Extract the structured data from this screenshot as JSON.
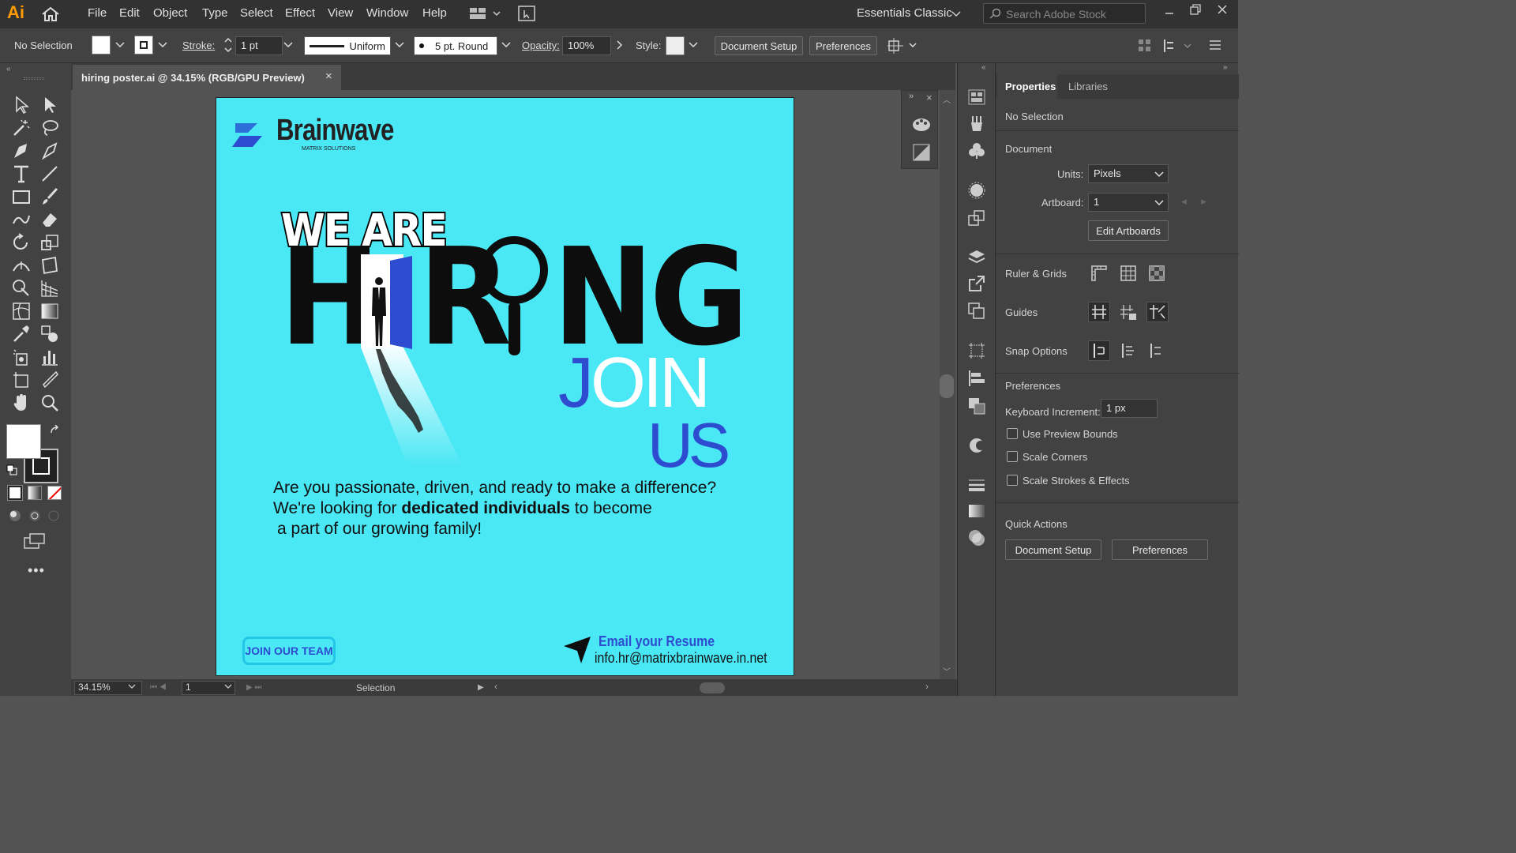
{
  "app": {
    "logo": "Ai",
    "home_icon": "home-icon"
  },
  "menu": [
    "File",
    "Edit",
    "Object",
    "Type",
    "Select",
    "Effect",
    "View",
    "Window",
    "Help"
  ],
  "workspace": "Essentials Classic",
  "search_placeholder": "Search Adobe Stock",
  "control": {
    "selection": "No Selection",
    "stroke_label": "Stroke:",
    "stroke_value": "1 pt",
    "profile": "Uniform",
    "brush": "5 pt. Round",
    "opacity_label": "Opacity:",
    "opacity_value": "100%",
    "style_label": "Style:",
    "doc_setup": "Document Setup",
    "preferences": "Preferences"
  },
  "document": {
    "tab_title": "hiring poster.ai @ 34.15% (RGB/GPU Preview)",
    "close": "×"
  },
  "poster": {
    "brand": "Brainwave",
    "brand_sub": "MATRIX SOLUTIONS",
    "we_are": "WE ARE",
    "hiring_h": "H",
    "hiring_r": "R",
    "hiring_ng": "NG",
    "join": "JOIN",
    "us": "US",
    "line1": "Are you passionate, driven, and ready to make a difference?",
    "line2a": "We're looking for ",
    "line2b": "dedicated individuals",
    "line2c": " to become",
    "line3": "a part of our growing family!",
    "cta": "JOIN OUR TEAM",
    "email_title": "Email your Resume",
    "email": "info.hr@matrixbrainwave.in.net",
    "colors": {
      "bg": "#4ae7f5",
      "blue": "#2d4ccf",
      "dark": "#111111"
    }
  },
  "properties": {
    "tab_properties": "Properties",
    "tab_libraries": "Libraries",
    "no_selection": "No Selection",
    "document": "Document",
    "units_label": "Units:",
    "units_value": "Pixels",
    "artboard_label": "Artboard:",
    "artboard_value": "1",
    "edit_artboards": "Edit Artboards",
    "ruler_grids": "Ruler & Grids",
    "guides": "Guides",
    "snap_options": "Snap Options",
    "preferences": "Preferences",
    "keyboard_increment_label": "Keyboard Increment:",
    "keyboard_increment_value": "1 px",
    "use_preview_bounds": "Use Preview Bounds",
    "scale_corners": "Scale Corners",
    "scale_strokes": "Scale Strokes & Effects",
    "quick_actions": "Quick Actions",
    "qa_doc_setup": "Document Setup",
    "qa_preferences": "Preferences"
  },
  "status": {
    "zoom": "34.15%",
    "artboard": "1",
    "tool": "Selection"
  }
}
